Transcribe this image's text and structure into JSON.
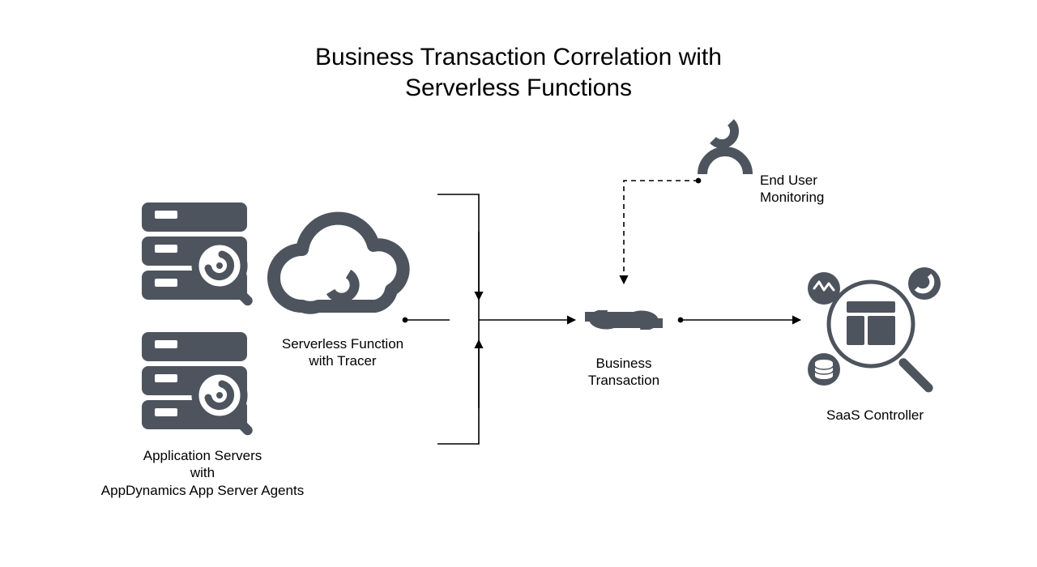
{
  "title_line1": "Business Transaction Correlation with",
  "title_line2": "Serverless Functions",
  "labels": {
    "app_servers_l1": "Application Servers",
    "app_servers_l2": "with",
    "app_servers_l3": "AppDynamics App Server Agents",
    "serverless_l1": "Serverless Function",
    "serverless_l2": "with Tracer",
    "business_tx_l1": "Business",
    "business_tx_l2": "Transaction",
    "eum_l1": "End User",
    "eum_l2": "Monitoring",
    "saas": "SaaS Controller"
  },
  "colors": {
    "icon": "#4d545e",
    "line": "#000000"
  }
}
